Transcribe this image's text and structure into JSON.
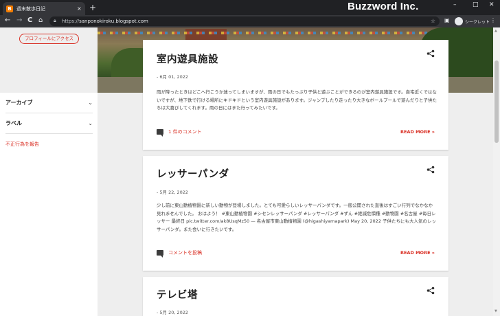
{
  "browser": {
    "tab_title": "週末散歩日記",
    "favicon": "B",
    "tab_close": "×",
    "new_tab": "+",
    "brand": "Buzzword Inc.",
    "window_controls": [
      "–",
      "□",
      "✕"
    ],
    "nav": [
      "←",
      "→",
      "C",
      "⌂"
    ],
    "url_scheme": "https://",
    "url_host": "sanponokiroku.blogspot.com",
    "incognito_label": "シークレット",
    "menu": "⋮"
  },
  "sidebar": {
    "profile_button": "プロフィールにアクセス",
    "items": [
      {
        "label": "アーカイブ",
        "chevron": "⌄"
      },
      {
        "label": "ラベル",
        "chevron": "⌄"
      }
    ],
    "report_link": "不正行為を報告"
  },
  "posts": [
    {
      "title": "室内遊具施設",
      "date": "- 6月 01, 2022",
      "body": "雨が降ったときはどこへ行こうか迷ってしまいますが、雨の日でもたっぷり子供と遊ぶことができるのが室内遊具施設です。自宅近くではないですが、地下鉄で行ける場所にキドキドという室内遊具施設があります。ジャンプしたり走ったり大きなボールプールで遊んだりと子供たちは大喜びしてくれます。雨の日にはまた行ってみたいです。",
      "comment": "1 件のコメント",
      "more": "READ MORE »"
    },
    {
      "title": "レッサーパンダ",
      "date": "- 5月 22, 2022",
      "body": "少し前に東山動植物園に新しい動物が登場しました。とても可愛らしいレッサーパンダです。一般公開された直後はすごい行列でなかなか見れませんでした。 おはよう！ #東山動植物園 #シセンレッサーパンダ #レッサーパンダ #ずん #絶滅危惧種 #動物園 #名古屋 #毎日レッサー 最終日 pic.twitter.com/ak8UsqMz50 — 名古屋市東山動植物園 (@higashiyamapark) May 20, 2022 子供たちにも大人気のレッサーパンダ。また会いに行きたいです。",
      "comment": "コメントを投稿",
      "more": "READ MORE »"
    },
    {
      "title": "テレビ塔",
      "date": "- 5月 20, 2022"
    }
  ],
  "colors": {
    "accent": "#d93025",
    "chrome_dark": "#202124",
    "chrome_mid": "#35363a"
  }
}
